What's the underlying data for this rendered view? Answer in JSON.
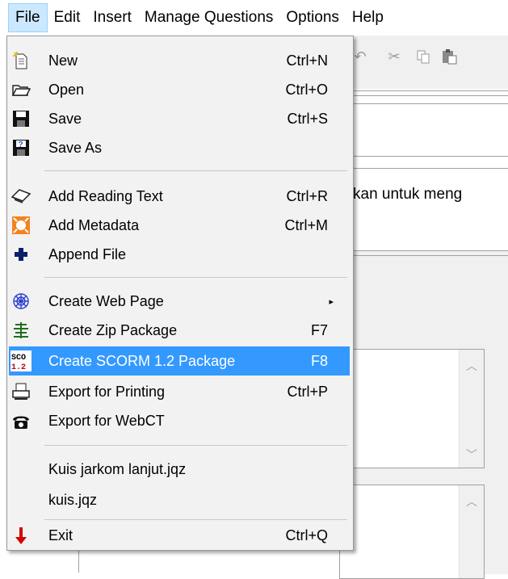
{
  "menubar": {
    "items": [
      "File",
      "Edit",
      "Insert",
      "Manage Questions",
      "Options",
      "Help"
    ]
  },
  "background": {
    "text_fragment": "kan untuk meng",
    "toolbar_icons": [
      "undo-icon",
      "cut-icon",
      "copy-icon",
      "paste-icon"
    ]
  },
  "file_menu": {
    "items": [
      {
        "label": "New",
        "shortcut": "Ctrl+N",
        "icon": "new-file-icon"
      },
      {
        "label": "Open",
        "shortcut": "Ctrl+O",
        "icon": "open-folder-icon"
      },
      {
        "label": "Save",
        "shortcut": "Ctrl+S",
        "icon": "save-icon"
      },
      {
        "label": "Save As",
        "shortcut": "",
        "icon": "save-as-icon"
      },
      {
        "label": "Add Reading Text",
        "shortcut": "Ctrl+R",
        "icon": "reading-text-icon"
      },
      {
        "label": "Add Metadata",
        "shortcut": "Ctrl+M",
        "icon": "metadata-icon"
      },
      {
        "label": "Append File",
        "shortcut": "",
        "icon": "plus-icon"
      },
      {
        "label": "Create Web Page",
        "shortcut": "",
        "icon": "web-page-icon",
        "submenu_arrow": "▸"
      },
      {
        "label": "Create Zip Package",
        "shortcut": "F7",
        "icon": "zip-package-icon"
      },
      {
        "label": "Create SCORM 1.2 Package",
        "shortcut": "F8",
        "icon": "scorm-icon",
        "icon_text_top": "SCO",
        "icon_text_bottom": "1.2",
        "highlighted": true
      },
      {
        "label": "Export for Printing",
        "shortcut": "Ctrl+P",
        "icon": "printer-icon"
      },
      {
        "label": "Export for WebCT",
        "shortcut": "",
        "icon": "webct-icon"
      },
      {
        "label": "Kuis jarkom lanjut.jqz",
        "shortcut": "",
        "icon": ""
      },
      {
        "label": "kuis.jqz",
        "shortcut": "",
        "icon": ""
      },
      {
        "label": "Exit",
        "shortcut": "Ctrl+Q",
        "icon": "exit-arrow-icon"
      }
    ]
  },
  "colors": {
    "highlight": "#3399ff",
    "menu_bg": "#f2f2f2",
    "active_menu": "#cce8ff"
  }
}
